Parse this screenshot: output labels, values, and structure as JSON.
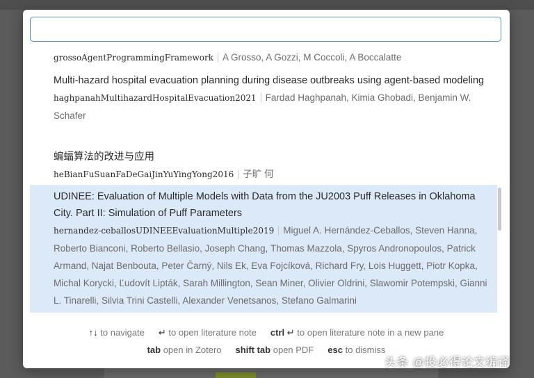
{
  "search": {
    "value": "",
    "placeholder": ""
  },
  "results": [
    {
      "title": "",
      "key": "grossoAgentProgrammingFramework",
      "authors": "A Grosso, A Gozzi, M Coccoli, A Boccalatte"
    },
    {
      "title": "Multi-hazard hospital evacuation planning during disease outbreaks using agent-based modeling",
      "key": "haghpanahMultihazardHospitalEvacuation2021",
      "authors": "Fardad Haghpanah, Kimia Ghobadi, Benjamin W. Schafer"
    },
    {
      "title": "蝙蝠算法的改进与应用",
      "key": "heBianFuSuanFaDeGaiJinYuYingYong2016",
      "authors": "子旷 何"
    },
    {
      "title": "UDINEE: Evaluation of Multiple Models with Data from the JU2003 Puff Releases in Oklahoma City. Part II: Simulation of Puff Parameters",
      "key": "hernandez-ceballosUDINEEEvaluationMultiple2019",
      "authors": "Miguel A. Hernández-Ceballos, Steven Hanna, Roberto Bianconi, Roberto Bellasio, Joseph Chang, Thomas Mazzola, Spyros Andronopoulos, Patrick Armand, Najat Benbouta, Peter Čarný, Nils Ek, Eva Fojcíková, Richard Fry, Lois Huggett, Piotr Kopka, Michal Korycki, Ľudovít Lipták, Sarah Millington, Sean Miner, Olivier Oldrini, Slawomir Potempski, Gianni L. Tinarelli, Silvia Trini Castelli, Alexander Venetsanos, Stefano Galmarini",
      "selected": true
    }
  ],
  "footer": {
    "navigate_keys": "↑↓",
    "navigate_label": "to navigate",
    "open_key": "↵",
    "open_label": "to open literature note",
    "ctrl_key": "ctrl",
    "ctrl_enter": "↵",
    "ctrl_label": "to open literature note in a new pane",
    "tab_key": "tab",
    "tab_label": "open in Zotero",
    "shifttab_key": "shift tab",
    "shifttab_label": "open PDF",
    "esc_key": "esc",
    "esc_label": "to dismiss"
  },
  "watermark": "头条 @投必得论文编译"
}
